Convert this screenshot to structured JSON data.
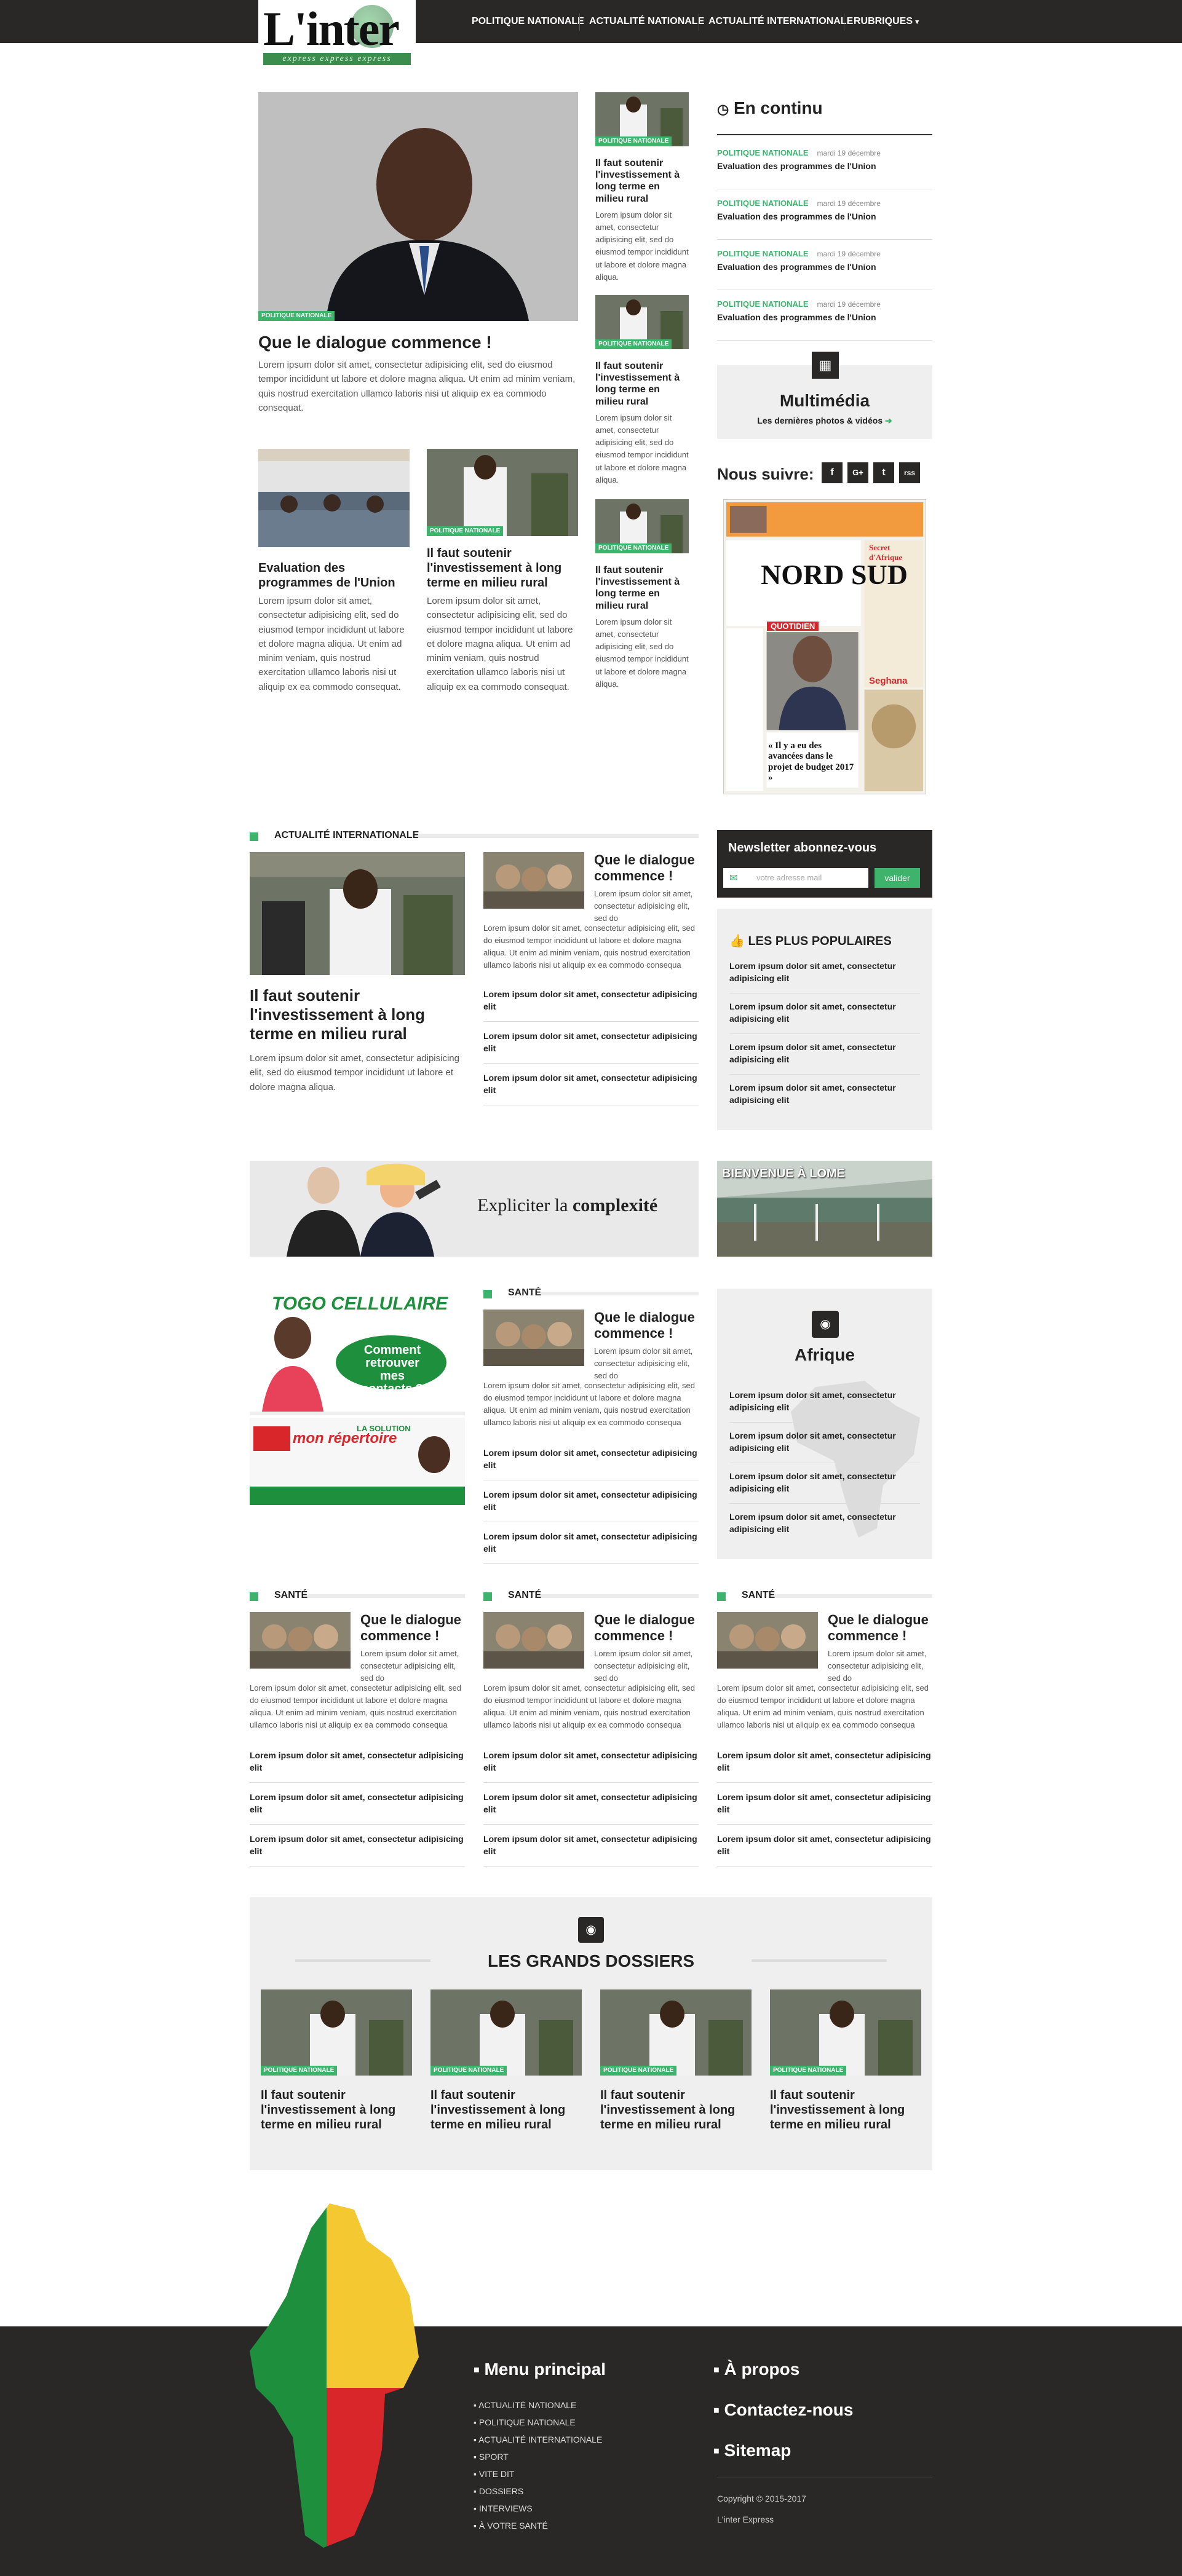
{
  "brand": {
    "logo_text": "L'inter",
    "tagline": "express express express"
  },
  "nav": [
    {
      "label": "POLITIQUE NATIONALE"
    },
    {
      "label": "ACTUALITÉ NATIONALE"
    },
    {
      "label": "ACTUALITÉ INTERNATIONALE"
    },
    {
      "label": "RUBRIQUES"
    }
  ],
  "hero": {
    "tag": "POLITIQUE NATIONALE",
    "title": "Que le dialogue commence !",
    "text": "Lorem ipsum dolor sit amet, consectetur adipisicing elit, sed do eiusmod tempor incididunt ut labore et dolore magna aliqua. Ut enim ad minim veniam, quis nostrud exercitation ullamco laboris nisi ut aliquip ex ea commodo consequat."
  },
  "mid_articles": [
    {
      "title": "Evaluation des programmes de l'Union",
      "text": "Lorem ipsum dolor sit amet, consectetur adipisicing elit, sed do eiusmod tempor incididunt ut labore et dolore magna aliqua. Ut enim ad minim veniam, quis nostrud exercitation ullamco laboris nisi ut aliquip ex ea commodo consequat."
    },
    {
      "tag": "POLITIQUE NATIONALE",
      "title": "Il faut soutenir l'investissement à long terme en milieu rural",
      "text": "Lorem ipsum dolor sit amet, consectetur adipisicing elit, sed do eiusmod tempor incididunt ut labore et dolore magna aliqua. Ut enim ad minim veniam, quis nostrud exercitation ullamco laboris nisi ut aliquip ex ea commodo consequat."
    }
  ],
  "side_articles": [
    {
      "tag": "POLITIQUE NATIONALE",
      "title": "Il faut soutenir l'investissement à long terme en milieu rural",
      "text": "Lorem ipsum dolor sit amet, consectetur adipisicing elit, sed do eiusmod tempor incididunt ut labore et dolore magna aliqua."
    },
    {
      "tag": "POLITIQUE NATIONALE",
      "title": "Il faut soutenir l'investissement à long terme en milieu rural",
      "text": "Lorem ipsum dolor sit amet, consectetur adipisicing elit, sed do eiusmod tempor incididunt ut labore et dolore magna aliqua."
    },
    {
      "tag": "POLITIQUE NATIONALE",
      "title": "Il faut soutenir l'investissement à long terme en milieu rural",
      "text": "Lorem ipsum dolor sit amet, consectetur adipisicing elit, sed do eiusmod tempor incididunt ut labore et dolore magna aliqua."
    }
  ],
  "en_continu": {
    "title": "En continu",
    "items": [
      {
        "cat": "POLITIQUE NATIONALE",
        "date": "mardi 19 décembre",
        "title": "Evaluation des programmes de l'Union"
      },
      {
        "cat": "POLITIQUE NATIONALE",
        "date": "mardi 19 décembre",
        "title": "Evaluation des programmes de l'Union"
      },
      {
        "cat": "POLITIQUE NATIONALE",
        "date": "mardi 19 décembre",
        "title": "Evaluation des programmes de l'Union"
      },
      {
        "cat": "POLITIQUE NATIONALE",
        "date": "mardi 19 décembre",
        "title": "Evaluation des programmes de l'Union"
      }
    ]
  },
  "multimedia": {
    "title": "Multimédia",
    "subtitle": "Les dernières photos & vidéos"
  },
  "follow": {
    "label": "Nous suivre:",
    "networks": [
      "f",
      "G+",
      "t",
      "rss"
    ]
  },
  "newspaper": {
    "name": "NORD SUD",
    "sub": "QUOTIDIEN",
    "headline": "« Il y a eu des avancées dans le projet de budget 2017 »",
    "side_title": "Secret d'Afrique",
    "side_title2": "Seghana"
  },
  "intl": {
    "heading": "ACTUALITÉ INTERNATIONALE",
    "main_title": "Il faut soutenir l'investissement à long terme en milieu rural",
    "main_text": "Lorem ipsum dolor sit amet, consectetur adipisicing elit, sed do eiusmod tempor incididunt ut labore et dolore magna aliqua.",
    "secondary_title": "Que le dialogue commence !",
    "secondary_text": "Lorem ipsum dolor sit amet, consectetur adipisicing elit, sed do eiusmod tempor incididunt ut labore et dolore magna aliqua. Ut enim ad minim veniam, quis nostrud exercitation ullamco laboris nisi ut aliquip ex ea commodo consequa",
    "links": [
      "Lorem ipsum dolor sit amet, consectetur adipisicing elit",
      "Lorem ipsum dolor sit amet, consectetur adipisicing elit",
      "Lorem ipsum dolor sit amet, consectetur adipisicing elit"
    ]
  },
  "newsletter": {
    "title": "Newsletter abonnez-vous",
    "placeholder": "votre adresse mail",
    "button": "valider"
  },
  "popular": {
    "title": "LES PLUS POPULAIRES",
    "items": [
      "Lorem ipsum dolor sit amet, consectetur adipisicing elit",
      "Lorem ipsum dolor sit amet, consectetur adipisicing elit",
      "Lorem ipsum dolor sit amet, consectetur adipisicing elit",
      "Lorem ipsum dolor sit amet, consectetur adipisicing elit"
    ]
  },
  "banner": {
    "text_prefix": "Expliciter la ",
    "text_strong": "complexité"
  },
  "lome": {
    "caption": "BIENVENUE À LOME"
  },
  "ad": {
    "title": "TOGO CELLULAIRE",
    "bubble": "Comment retrouver mes contacts ?",
    "brand": "mon répertoire",
    "solution": "LA SOLUTION"
  },
  "sante_main": {
    "heading": "SANTÉ",
    "title": "Que le dialogue commence !",
    "text": "Lorem ipsum dolor sit amet, consectetur adipisicing elit, sed do eiusmod tempor incididunt ut labore et dolore magna aliqua. Ut enim ad minim veniam, quis nostrud exercitation ullamco laboris nisi ut aliquip ex ea commodo consequa",
    "links": [
      "Lorem ipsum dolor sit amet, consectetur adipisicing elit",
      "Lorem ipsum dolor sit amet, consectetur adipisicing elit",
      "Lorem ipsum dolor sit amet, consectetur adipisicing elit"
    ]
  },
  "afrique": {
    "title": "Afrique",
    "items": [
      "Lorem ipsum dolor sit amet, consectetur adipisicing elit",
      "Lorem ipsum dolor sit amet, consectetur adipisicing elit",
      "Lorem ipsum dolor sit amet, consectetur adipisicing elit",
      "Lorem ipsum dolor sit amet, consectetur adipisicing elit"
    ]
  },
  "sante_cols": [
    {
      "heading": "SANTÉ",
      "title": "Que le dialogue commence !",
      "text": "Lorem ipsum dolor sit amet, consectetur adipisicing elit, sed do eiusmod tempor incididunt ut labore et dolore magna aliqua. Ut enim ad minim veniam, quis nostrud exercitation ullamco laboris nisi ut aliquip ex ea commodo consequa",
      "links": [
        "Lorem ipsum dolor sit amet, consectetur adipisicing elit",
        "Lorem ipsum dolor sit amet, consectetur adipisicing elit",
        "Lorem ipsum dolor sit amet, consectetur adipisicing elit"
      ]
    },
    {
      "heading": "SANTÉ",
      "title": "Que le dialogue commence !",
      "text": "Lorem ipsum dolor sit amet, consectetur adipisicing elit, sed do eiusmod tempor incididunt ut labore et dolore magna aliqua. Ut enim ad minim veniam, quis nostrud exercitation ullamco laboris nisi ut aliquip ex ea commodo consequa",
      "links": [
        "Lorem ipsum dolor sit amet, consectetur adipisicing elit",
        "Lorem ipsum dolor sit amet, consectetur adipisicing elit",
        "Lorem ipsum dolor sit amet, consectetur adipisicing elit"
      ]
    },
    {
      "heading": "SANTÉ",
      "title": "Que le dialogue commence !",
      "text": "Lorem ipsum dolor sit amet, consectetur adipisicing elit, sed do eiusmod tempor incididunt ut labore et dolore magna aliqua. Ut enim ad minim veniam, quis nostrud exercitation ullamco laboris nisi ut aliquip ex ea commodo consequa",
      "links": [
        "Lorem ipsum dolor sit amet, consectetur adipisicing elit",
        "Lorem ipsum dolor sit amet, consectetur adipisicing elit",
        "Lorem ipsum dolor sit amet, consectetur adipisicing elit"
      ]
    }
  ],
  "dossiers": {
    "title": "LES GRANDS DOSSIERS",
    "items": [
      {
        "tag": "POLITIQUE NATIONALE",
        "title": "Il faut soutenir l'investissement à long terme en milieu rural"
      },
      {
        "tag": "POLITIQUE NATIONALE",
        "title": "Il faut soutenir l'investissement à long terme en milieu rural"
      },
      {
        "tag": "POLITIQUE NATIONALE",
        "title": "Il faut soutenir l'investissement à long terme en milieu rural"
      },
      {
        "tag": "POLITIQUE NATIONALE",
        "title": "Il faut soutenir l'investissement à long terme en milieu rural"
      }
    ]
  },
  "footer": {
    "menu_title": "Menu principal",
    "menu": [
      "ACTUALITÉ NATIONALE",
      "POLITIQUE NATIONALE",
      "ACTUALITÉ INTERNATIONALE",
      "SPORT",
      "VITE DIT",
      "DOSSIERS",
      "INTERVIEWS",
      "À VOTRE SANTÉ"
    ],
    "links": [
      "À propos",
      "Contactez-nous",
      "Sitemap"
    ],
    "copyright": "Copyright © 2015-2017",
    "company": "L'inter Express"
  },
  "colors": {
    "accent": "#3db36b",
    "dark": "#2a2727",
    "grey": "#efefef"
  }
}
